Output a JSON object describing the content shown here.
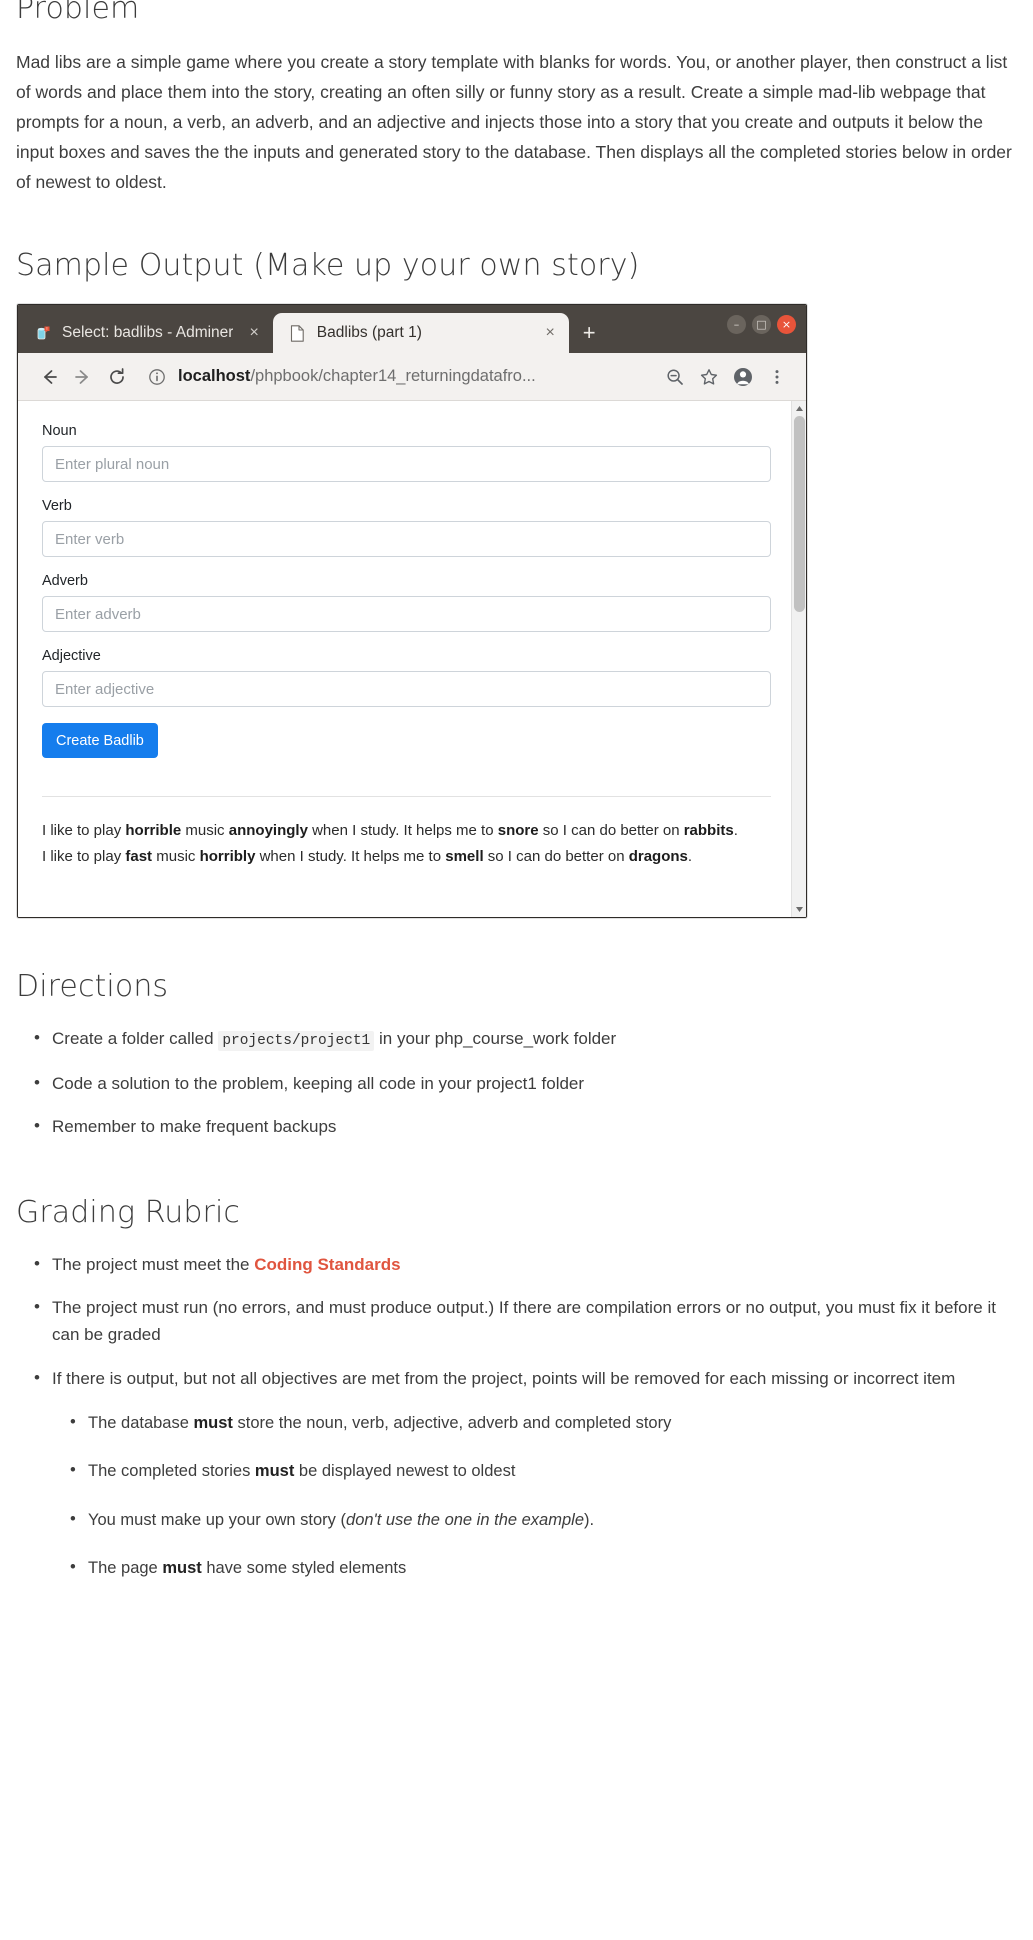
{
  "sections": {
    "problem": {
      "heading": "Problem",
      "paragraph": "Mad libs are a simple game where you create a story template with blanks for words. You, or another player, then construct a list of words and place them into the story, creating an often silly or funny story as a result. Create a simple mad-lib webpage that prompts for a noun, a verb, an adverb, and an adjective and injects those into a story that you create and outputs it below the input boxes and saves the the inputs and generated story to the database. Then displays all the completed stories below in order of newest to oldest."
    },
    "sample_output": {
      "heading": "Sample Output (Make up your own story)"
    },
    "directions": {
      "heading": "Directions",
      "items": [
        {
          "before": "Create a folder called ",
          "code": "projects/project1",
          "after": " in your php_course_work folder"
        },
        {
          "before": "Code a solution to the problem, keeping all code in your project1 folder",
          "code": "",
          "after": ""
        },
        {
          "before": "Remember to make frequent backups",
          "code": "",
          "after": ""
        }
      ]
    },
    "rubric": {
      "heading": "Grading Rubric",
      "item1_before": "The project must meet the ",
      "item1_link": "Coding Standards",
      "item2": "The project must run (no errors, and must produce output.) If there are compilation errors or no output, you must fix it before it can be graded",
      "item3": "If there is output, but not all objectives are met from the project, points will be removed for each missing or incorrect item",
      "subitems": [
        {
          "p1": "The database ",
          "b": "must",
          "p2": " store the noun, verb, adjective, adverb and completed story",
          "i": "",
          "p3": ""
        },
        {
          "p1": "The completed stories ",
          "b": "must",
          "p2": " be displayed newest to oldest",
          "i": "",
          "p3": ""
        },
        {
          "p1": "You must make up your own story (",
          "b": "",
          "p2": "",
          "i": "don't use the one in the example",
          "p3": ")."
        },
        {
          "p1": "The page ",
          "b": "must",
          "p2": " have some styled elements",
          "i": "",
          "p3": ""
        }
      ]
    }
  },
  "browser": {
    "tabs": [
      {
        "title": "Select: badlibs - Adminer",
        "close": "×",
        "active": false,
        "favicon": "database-icon"
      },
      {
        "title": "Badlibs (part 1)",
        "close": "×",
        "active": true,
        "favicon": "page-icon"
      }
    ],
    "new_tab_label": "+",
    "window_controls": {
      "minimize": "–",
      "maximize": "□",
      "close": "×"
    },
    "toolbar": {
      "back_icon": "back-arrow-icon",
      "forward_icon": "forward-arrow-icon",
      "reload_icon": "reload-icon",
      "info_icon": "site-info-icon",
      "url_domain": "localhost",
      "url_path": "/phpbook/chapter14_returningdatafro...",
      "zoom_icon": "zoom-out-icon",
      "bookmark_icon": "star-icon",
      "profile_icon": "account-icon",
      "menu_icon": "kebab-menu-icon"
    },
    "form": {
      "fields": [
        {
          "label": "Noun",
          "placeholder": "Enter plural noun",
          "value": ""
        },
        {
          "label": "Verb",
          "placeholder": "Enter verb",
          "value": ""
        },
        {
          "label": "Adverb",
          "placeholder": "Enter adverb",
          "value": ""
        },
        {
          "label": "Adjective",
          "placeholder": "Enter adjective",
          "value": ""
        }
      ],
      "submit_label": "Create Badlib",
      "submit_color": "#157ded"
    },
    "stories": [
      {
        "s1": "I like to play ",
        "w1": "horrible",
        "s2": " music ",
        "w2": "annoyingly",
        "s3": " when I study. It helps me to ",
        "w3": "snore",
        "s4": " so I can do better on ",
        "w4": "rabbits",
        "s5": "."
      },
      {
        "s1": "I like to play ",
        "w1": "fast",
        "s2": " music ",
        "w2": "horribly",
        "s3": " when I study. It helps me to ",
        "w3": "smell",
        "s4": " so I can do better on ",
        "w4": "dragons",
        "s5": "."
      }
    ]
  },
  "colors": {
    "titlebar": "#4b4641",
    "accent_blue": "#157ded",
    "link_red": "#e0553f",
    "close_red": "#e8543a"
  }
}
